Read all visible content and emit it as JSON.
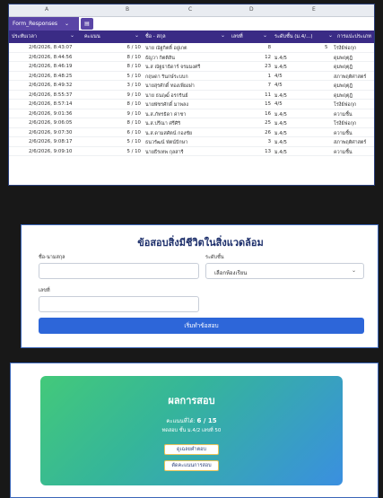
{
  "sheet": {
    "column_letters": [
      "A",
      "B",
      "C",
      "D",
      "E"
    ],
    "tab_name": "Form_Responses",
    "headers": [
      "ประทับเวลา",
      "คะแนน",
      "ชื่อ - สกุล",
      "เลขที่",
      "ระดับชั้น (ม.4/...)",
      "การแปะประเภท"
    ],
    "rows": [
      {
        "ts": "2/6/2026, 8:43:07",
        "score": "6 / 10",
        "name": "นาย ณัฐกิตติ์ อยู่เกต",
        "no": "8",
        "cls": "",
        "cat": "โรงีย์ฟอกุก",
        "extra": "5"
      },
      {
        "ts": "2/6/2026, 8:44:56",
        "score": "8 / 10",
        "name": "ธัญวา กิตติสิน",
        "no": "12",
        "cls": "ม.4/5",
        "cat": "ดุมพฤตุฎิ",
        "extra": ""
      },
      {
        "ts": "2/6/2026, 8:46:19",
        "score": "8 / 10",
        "name": "น.ส ณัฐธาธิดาร์ จรมมงศรี",
        "no": "23",
        "cls": "ม.4/5",
        "cat": "ดุมพฤตุฎิ",
        "extra": ""
      },
      {
        "ts": "2/6/2026, 8:48:25",
        "score": "5 / 10",
        "name": "กฤษดา รินกษ์ระบบก",
        "no": "1",
        "cls": "4/5",
        "cat": "สภาพฤติศาสตร์",
        "extra": ""
      },
      {
        "ts": "2/6/2026, 8:49:32",
        "score": "3 / 10",
        "name": "นายสุรศักดิ์ ทองเพียงฝา",
        "no": "7",
        "cls": "4/5",
        "cat": "ดุมพฤตุฎิ",
        "extra": ""
      },
      {
        "ts": "2/6/2026, 8:55:37",
        "score": "9 / 10",
        "name": "นาย ธนฤฒิ์ อรกรินย์",
        "no": "11",
        "cls": "ม.4/5",
        "cat": "ดุมพฤตุฎิ",
        "extra": ""
      },
      {
        "ts": "2/6/2026, 8:57:14",
        "score": "8 / 10",
        "name": "นายพัชรศักดิ์ มาพลง",
        "no": "15",
        "cls": "4/5",
        "cat": "โรงีย์ฟอกุก",
        "extra": ""
      },
      {
        "ts": "2/6/2026, 9:01:36",
        "score": "9 / 10",
        "name": "น.ส.ภัทรธิดา ค่าชา",
        "no": "16",
        "cls": "ม.4/5",
        "cat": "ความชื้น",
        "extra": ""
      },
      {
        "ts": "2/6/2026, 9:06:05",
        "score": "8 / 10",
        "name": "น.ส.ปรีณา ศรีศิริ",
        "no": "25",
        "cls": "ม.4/5",
        "cat": "โรงีย์ฟอกุก",
        "extra": ""
      },
      {
        "ts": "2/6/2026, 9:07:30",
        "score": "6 / 10",
        "name": "น.ส.ดามสศัตน์ กองชัย",
        "no": "26",
        "cls": "ม.4/5",
        "cat": "ความชื้น",
        "extra": ""
      },
      {
        "ts": "2/6/2026, 9:08:17",
        "score": "5 / 10",
        "name": "ธนวรัฒน์ พัตน์ปักษา",
        "no": "3",
        "cls": "ม.4/5",
        "cat": "สภาพฤติศาสตร์",
        "extra": ""
      },
      {
        "ts": "2/6/2026, 9:09:10",
        "score": "5 / 10",
        "name": "นายธีรเทพ กุลสารี",
        "no": "13",
        "cls": "ม.4/5",
        "cat": "ความชื้น",
        "extra": ""
      }
    ]
  },
  "form": {
    "title": "ข้อสอบสิ่งมีชีวิตในสิ่งแวดล้อม",
    "name_label": "ชื่อ-นามสกุล",
    "class_label": "ระดับชั้น",
    "class_selected": "เลือกห้องเรียน",
    "number_label": "เลขที่",
    "start_button": "เริ่มทำข้อสอบ"
  },
  "result": {
    "title": "ผลการสอบ",
    "score_prefix": "คะแนนที่ได้:",
    "score_value": "6 / 15",
    "student": "ทดสอบ ชั้น ม.4/2 เลขที่ 50",
    "view_answers_button": "ดูเฉลยคำตอบ",
    "retake_button": "ตัดคะแนนการสอบ"
  }
}
